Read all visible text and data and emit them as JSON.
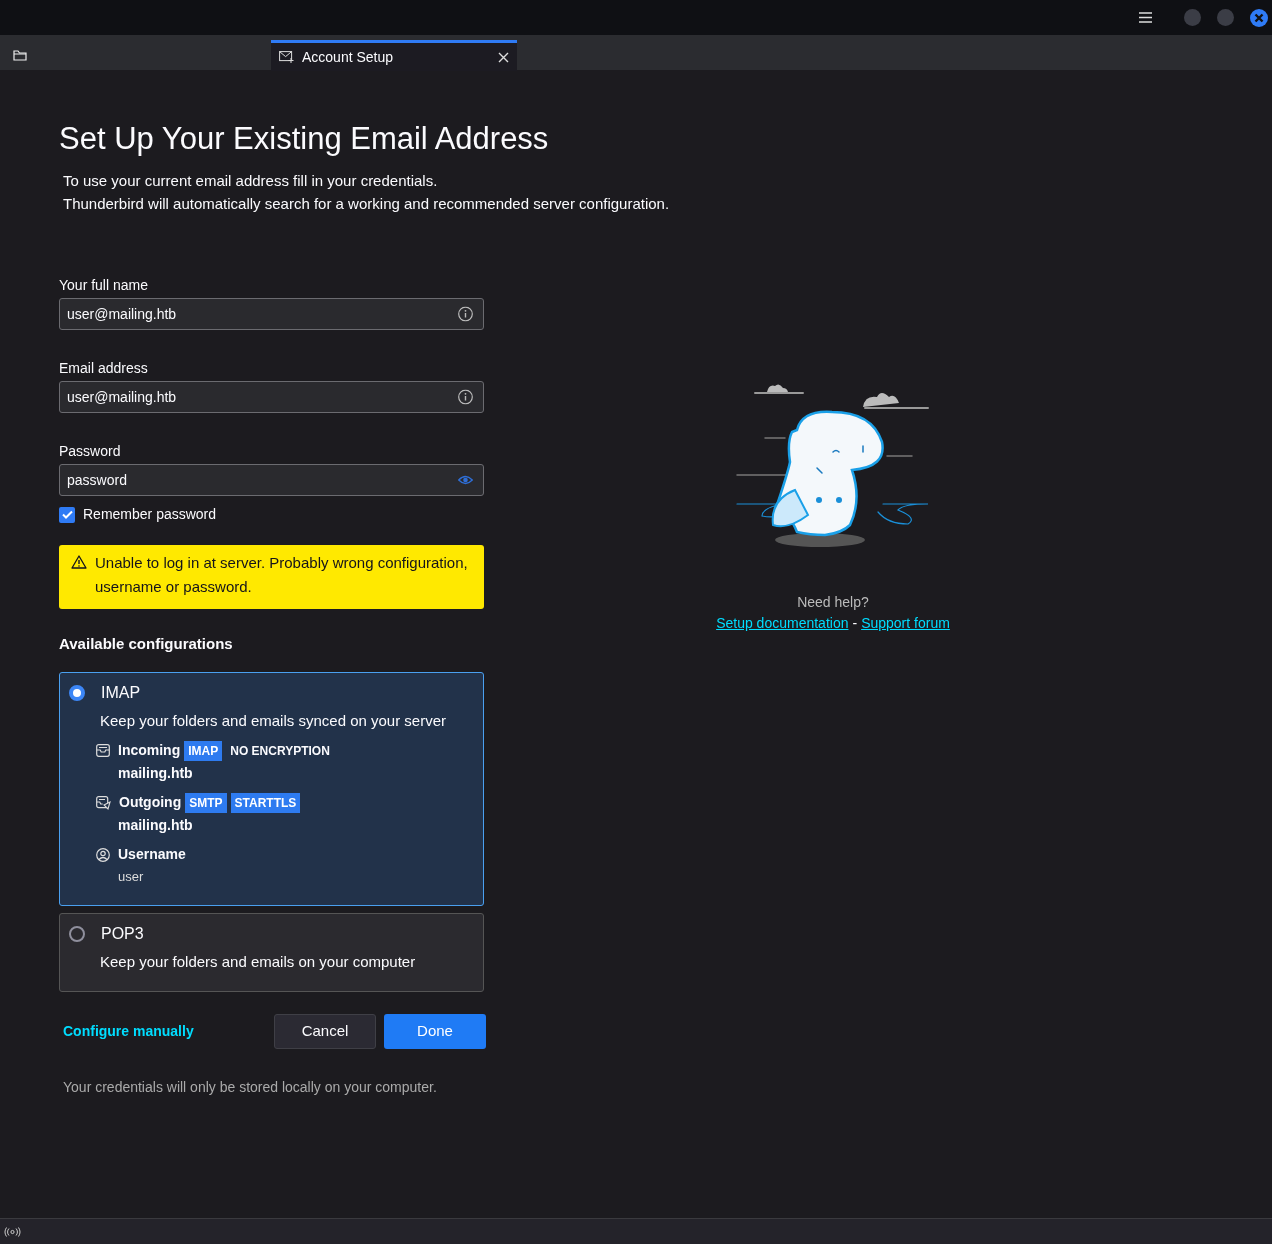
{
  "tabs": [
    {
      "label": "Account Setup",
      "selected": true
    }
  ],
  "heading": "Set Up Your Existing Email Address",
  "intro": [
    "To use your current email address fill in your credentials.",
    "Thunderbird will automatically search for a working and recommended server configuration."
  ],
  "fields": [
    {
      "label": "Your full name",
      "value": "user@mailing.htb",
      "kind": "info"
    },
    {
      "label": "Email address",
      "value": "user@mailing.htb",
      "kind": "info"
    },
    {
      "label": "Password",
      "value": "password",
      "kind": "password"
    }
  ],
  "remember_password": {
    "label": "Remember password",
    "checked": true
  },
  "warning": "Unable to log in at server. Probably wrong configuration, username or password.",
  "configs_title": "Available configurations",
  "configurations": [
    {
      "name": "IMAP",
      "selected": true,
      "description": "Keep your folders and emails synced on your server",
      "details": [
        {
          "kind": "incoming",
          "label": "Incoming",
          "tags": [
            "IMAP"
          ],
          "note": "NO ENCRYPTION",
          "value": "mailing.htb"
        },
        {
          "kind": "outgoing",
          "label": "Outgoing",
          "tags": [
            "SMTP",
            "STARTTLS"
          ],
          "value": "mailing.htb"
        },
        {
          "kind": "username",
          "label": "Username",
          "value": "user"
        }
      ]
    },
    {
      "name": "POP3",
      "selected": false,
      "description": "Keep your folders and emails on your computer"
    }
  ],
  "configure_manually": "Configure manually",
  "buttons": [
    {
      "label": "Cancel",
      "kind": "secondary"
    },
    {
      "label": "Done",
      "kind": "primary"
    }
  ],
  "footer_note": "Your credentials will only be stored locally on your computer.",
  "help": {
    "title": "Need help?",
    "links": [
      "Setup documentation",
      "Support forum"
    ],
    "separator": "-"
  }
}
